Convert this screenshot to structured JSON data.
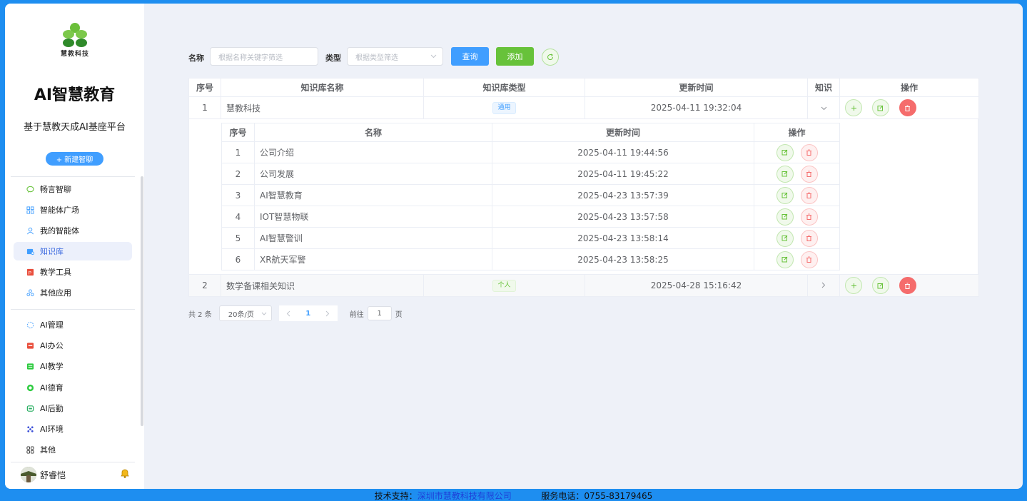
{
  "sidebar": {
    "logo_text": "慧教科技",
    "title": "AI智慧教育",
    "subtitle": "基于慧教天成AI基座平台",
    "new_chat": "+ 新建智聊",
    "primary_items": [
      {
        "label": "畅言智聊",
        "icon": "chat-icon",
        "color": "#67c23a"
      },
      {
        "label": "智能体广场",
        "icon": "grid-icon",
        "color": "#409eff"
      },
      {
        "label": "我的智能体",
        "icon": "user-icon",
        "color": "#409eff"
      },
      {
        "label": "知识库",
        "icon": "database-icon",
        "color": "#409eff"
      },
      {
        "label": "教学工具",
        "icon": "ppt-icon",
        "color": "#e94e3c"
      },
      {
        "label": "其他应用",
        "icon": "apps-icon",
        "color": "#409eff"
      }
    ],
    "secondary_items": [
      {
        "label": "AI管理",
        "icon": "loading-icon",
        "color": "#409eff"
      },
      {
        "label": "AI办公",
        "icon": "office-icon",
        "color": "#e94e3c"
      },
      {
        "label": "AI教学",
        "icon": "teach-icon",
        "color": "#2ecc40"
      },
      {
        "label": "AI德育",
        "icon": "moral-icon",
        "color": "#2ecc40"
      },
      {
        "label": "AI后勤",
        "icon": "logistics-icon",
        "color": "#27ae60"
      },
      {
        "label": "AI环境",
        "icon": "environment-icon",
        "color": "#3b4fd8"
      },
      {
        "label": "其他",
        "icon": "more-grid-icon",
        "color": "#333333"
      }
    ],
    "user_name": "舒睿恺",
    "active_item": "知识库"
  },
  "filter": {
    "name_label": "名称",
    "name_placeholder": "根据名称关键字筛选",
    "type_label": "类型",
    "type_placeholder": "根据类型筛选",
    "query_button": "查询",
    "add_button": "添加"
  },
  "table": {
    "headers": [
      "序号",
      "知识库名称",
      "知识库类型",
      "更新时间",
      "知识",
      "操作"
    ],
    "rows": [
      {
        "index": "1",
        "name": "慧教科技",
        "type": "通用",
        "updated": "2025-04-11 19:32:04",
        "expanded": true
      },
      {
        "index": "2",
        "name": "数学备课相关知识",
        "type": "个人",
        "updated": "2025-04-28 15:16:42",
        "expanded": false
      }
    ],
    "sub_headers": [
      "序号",
      "名称",
      "更新时间",
      "操作"
    ],
    "sub_rows": [
      {
        "index": "1",
        "name": "公司介绍",
        "updated": "2025-04-11 19:44:56"
      },
      {
        "index": "2",
        "name": "公司发展",
        "updated": "2025-04-11 19:45:22"
      },
      {
        "index": "3",
        "name": "AI智慧教育",
        "updated": "2025-04-23 13:57:39"
      },
      {
        "index": "4",
        "name": "IOT智慧物联",
        "updated": "2025-04-23 13:57:58"
      },
      {
        "index": "5",
        "name": "AI智慧警训",
        "updated": "2025-04-23 13:58:14"
      },
      {
        "index": "6",
        "name": "XR航天军警",
        "updated": "2025-04-23 13:58:25"
      }
    ]
  },
  "pagination": {
    "total": "共 2 条",
    "page_size": "20条/页",
    "current_page": "1",
    "goto_label": "前往",
    "goto_value": "1",
    "page_suffix": "页"
  },
  "footer": {
    "support_label": "技术支持：",
    "company": "深圳市慧教科技有限公司",
    "phone_label": "服务电话：0755-83179465"
  }
}
